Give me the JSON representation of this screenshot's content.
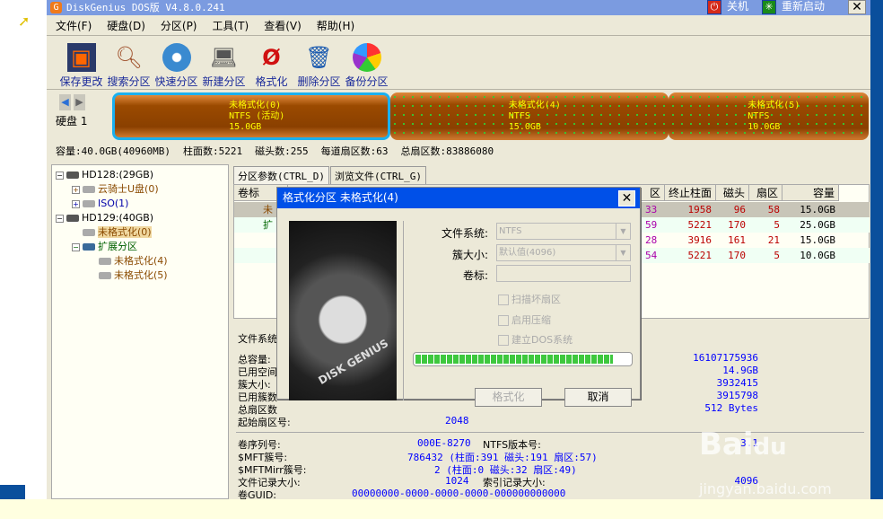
{
  "window": {
    "title": "DiskGenius DOS版 V4.8.0.241",
    "shutdown": "关机",
    "restart": "重新启动"
  },
  "menu": [
    "文件(F)",
    "硬盘(D)",
    "分区(P)",
    "工具(T)",
    "查看(V)",
    "帮助(H)"
  ],
  "toolbar": [
    {
      "label": "保存更改",
      "icon": "save-icon"
    },
    {
      "label": "搜索分区",
      "icon": "search-icon"
    },
    {
      "label": "快速分区",
      "icon": "quick-partition-icon"
    },
    {
      "label": "新建分区",
      "icon": "new-partition-icon"
    },
    {
      "label": "格式化",
      "icon": "format-icon"
    },
    {
      "label": "删除分区",
      "icon": "delete-icon"
    },
    {
      "label": "备份分区",
      "icon": "backup-icon"
    }
  ],
  "disk": {
    "label": "硬盘 1",
    "partitions": [
      {
        "name": "未格式化(0)",
        "fs": "NTFS (活动)",
        "size": "15.0GB"
      },
      {
        "name": "未格式化(4)",
        "fs": "NTFS",
        "size": "15.0GB"
      },
      {
        "name": "未格式化(5)",
        "fs": "NTFS",
        "size": "10.0GB"
      }
    ],
    "info": [
      "容量:40.0GB(40960MB)",
      "柱面数:5221",
      "磁头数:255",
      "每道扇区数:63",
      "总扇区数:83886080"
    ]
  },
  "tree": [
    {
      "t": "HD128:(29GB)",
      "c": "#000"
    },
    {
      "t": "云骑士U盘(0)",
      "c": "#8a4a00"
    },
    {
      "t": "ISO(1)",
      "c": "#00a"
    },
    {
      "t": "HD129:(40GB)",
      "c": "#000"
    },
    {
      "t": "未格式化(0)",
      "c": "#8a4a00"
    },
    {
      "t": "扩展分区",
      "c": "#006000"
    },
    {
      "t": "未格式化(4)",
      "c": "#8a4a00"
    },
    {
      "t": "未格式化(5)",
      "c": "#8a4a00"
    }
  ],
  "tabs": [
    "分区参数(CTRL_D)",
    "浏览文件(CTRL_G)"
  ],
  "table": {
    "headers": [
      "卷标",
      "区",
      "终止柱面",
      "磁头",
      "扇区",
      "容量"
    ],
    "rows": [
      {
        "label": "未",
        "s": "33",
        "cyl": "1958",
        "head": "96",
        "sec": "58",
        "cap": "15.0GB"
      },
      {
        "label": "扩",
        "s": "59",
        "cyl": "5221",
        "head": "170",
        "sec": "5",
        "cap": "25.0GB"
      },
      {
        "label": "",
        "s": "28",
        "cyl": "3916",
        "head": "161",
        "sec": "21",
        "cap": "15.0GB"
      },
      {
        "label": "",
        "s": "54",
        "cyl": "5221",
        "head": "170",
        "sec": "5",
        "cap": "10.0GB"
      }
    ]
  },
  "details": {
    "fs_label": "文件系统",
    "labels": [
      "总容量:",
      "已用空间",
      "簇大小:",
      "已用簇数",
      "总扇区数",
      "起始扇区号:"
    ],
    "values": [
      "16107175936",
      "14.9GB",
      "3932415",
      "3915798",
      "512 Bytes",
      "2048"
    ],
    "serial_label": "卷序列号:",
    "serial": "000E-8270",
    "ntfs_ver_label": "NTFS版本号:",
    "ntfs_ver": "3.1",
    "mft_label": "$MFT簇号:",
    "mft": "786432 (柱面:391 磁头:191 扇区:57)",
    "mftmirr_label": "$MFTMirr簇号:",
    "mftmirr": "2 (柱面:0 磁头:32 扇区:49)",
    "rec_label": "文件记录大小:",
    "rec": "1024",
    "idx_label": "索引记录大小:",
    "idx": "4096",
    "guid_label": "卷GUID:",
    "guid": "00000000-0000-0000-0000-000000000000"
  },
  "dialog": {
    "title": "格式化分区 未格式化(4)",
    "fs_label": "文件系统:",
    "fs_value": "NTFS",
    "cluster_label": "簇大小:",
    "cluster_value": "默认值(4096)",
    "vol_label": "卷标:",
    "vol_value": "",
    "checks": [
      "扫描坏扇区",
      "启用压缩",
      "建立DOS系统"
    ],
    "progress": 0.92,
    "format_btn": "格式化",
    "cancel_btn": "取消",
    "image_text": "DISK GENIUS"
  },
  "watermark": "jingyan.baidu.com",
  "colors": {
    "title": "#7b9be0",
    "dialog_title": "#0050e8",
    "progress": "#3ec83e"
  }
}
